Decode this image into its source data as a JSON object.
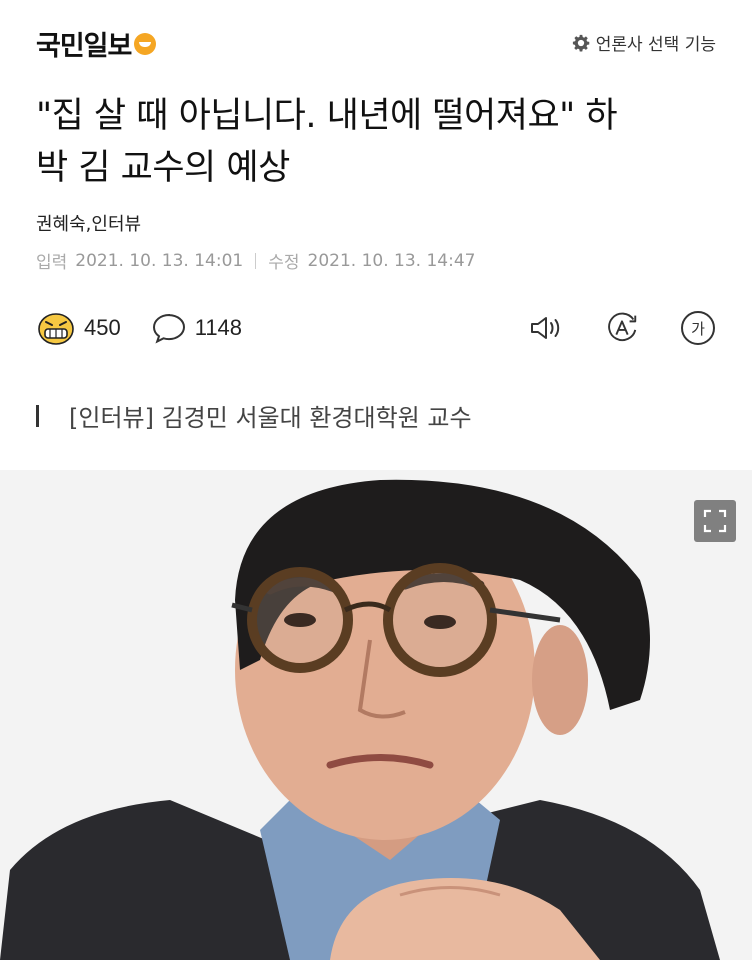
{
  "header": {
    "logo_text": "국민일보",
    "press_select_label": "언론사 선택 기능"
  },
  "article": {
    "title_line1": "\"집 살 때 아닙니다. 내년에 떨어져요\" 하",
    "title_line2": "박 김 교수의 예상",
    "byline": "권혜숙,인터뷰",
    "input_label": "입력",
    "input_date": "2021. 10. 13. 14:01",
    "modified_label": "수정",
    "modified_date": "2021. 10. 13. 14:47",
    "subhead": "[인터뷰] 김경민 서울대 환경대학원 교수"
  },
  "actions": {
    "reaction_count": "450",
    "comment_count": "1148",
    "audio_icon": "speaker-icon",
    "translate_icon": "font-A-icon",
    "text_size_label": "가"
  },
  "photo": {
    "expand_icon": "expand-icon"
  },
  "colors": {
    "logo_accent": "#f5a623",
    "muted_text": "#999999"
  }
}
